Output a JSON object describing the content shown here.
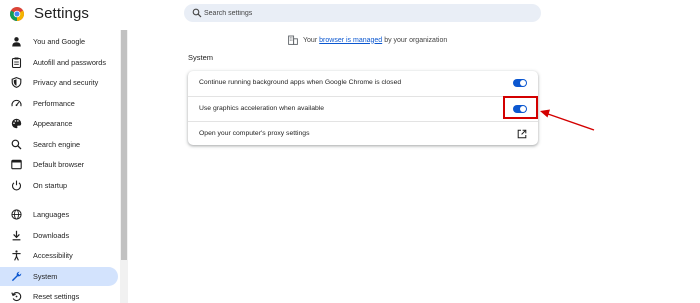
{
  "app": {
    "title": "Settings"
  },
  "search": {
    "placeholder": "Search settings"
  },
  "managed_notice": {
    "prefix": "Your",
    "link": "browser is managed",
    "suffix": "by your organization"
  },
  "sidebar": {
    "items": [
      {
        "label": "You and Google",
        "icon": "person-icon",
        "active": false
      },
      {
        "label": "Autofill and passwords",
        "icon": "clipboard-icon",
        "active": false
      },
      {
        "label": "Privacy and security",
        "icon": "shield-icon",
        "active": false
      },
      {
        "label": "Performance",
        "icon": "speedometer-icon",
        "active": false
      },
      {
        "label": "Appearance",
        "icon": "palette-icon",
        "active": false
      },
      {
        "label": "Search engine",
        "icon": "search-icon",
        "active": false
      },
      {
        "label": "Default browser",
        "icon": "browser-icon",
        "active": false
      },
      {
        "label": "On startup",
        "icon": "power-icon",
        "active": false
      },
      {
        "label": "Languages",
        "icon": "globe-icon",
        "active": false
      },
      {
        "label": "Downloads",
        "icon": "download-icon",
        "active": false
      },
      {
        "label": "Accessibility",
        "icon": "accessibility-icon",
        "active": false
      },
      {
        "label": "System",
        "icon": "wrench-icon",
        "active": true
      },
      {
        "label": "Reset settings",
        "icon": "reset-icon",
        "active": false
      }
    ]
  },
  "system": {
    "title": "System",
    "rows": [
      {
        "label": "Continue running background apps when Google Chrome is closed",
        "control": "toggle",
        "on": true
      },
      {
        "label": "Use graphics acceleration when available",
        "control": "toggle",
        "on": true
      },
      {
        "label": "Open your computer's proxy settings",
        "control": "external-link"
      }
    ]
  },
  "colors": {
    "accent": "#0b57d0",
    "active_nav": "#d3e3fd",
    "search_bg": "#e9eef6",
    "annotation": "#d30000"
  }
}
